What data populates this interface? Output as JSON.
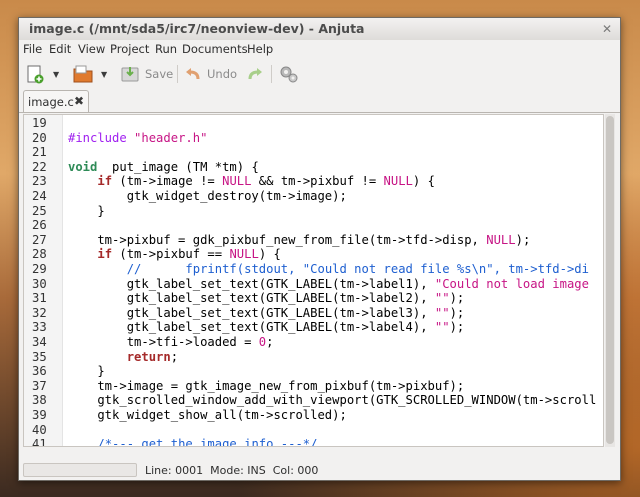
{
  "window": {
    "title": "image.c (/mnt/sda5/irc7/neonview-dev) - Anjuta",
    "close_glyph": "✕"
  },
  "menu": [
    "File",
    "Edit",
    "View",
    "Project",
    "Run",
    "Documents",
    "Help"
  ],
  "toolbar": {
    "save_label": "Save",
    "undo_label": "Undo"
  },
  "tab": {
    "label": "image.c",
    "close_glyph": "✖"
  },
  "editor": {
    "lines": [
      {
        "n": "19",
        "tokens": []
      },
      {
        "n": "20",
        "tokens": [
          [
            "pp",
            "#include "
          ],
          [
            "str",
            "\"header.h\""
          ]
        ]
      },
      {
        "n": "21",
        "tokens": []
      },
      {
        "n": "22",
        "tokens": [
          [
            "ty",
            "void"
          ],
          [
            "",
            "  put_image (TM *tm) {"
          ]
        ]
      },
      {
        "n": "23",
        "tokens": [
          [
            "",
            "    "
          ],
          [
            "kw",
            "if"
          ],
          [
            "",
            " (tm->image != "
          ],
          [
            "cn",
            "NULL"
          ],
          [
            "",
            " && tm->pixbuf != "
          ],
          [
            "cn",
            "NULL"
          ],
          [
            "",
            ") {"
          ]
        ]
      },
      {
        "n": "24",
        "tokens": [
          [
            "",
            "        gtk_widget_destroy(tm->image);"
          ]
        ]
      },
      {
        "n": "25",
        "tokens": [
          [
            "",
            "    }"
          ]
        ]
      },
      {
        "n": "26",
        "tokens": []
      },
      {
        "n": "27",
        "tokens": [
          [
            "",
            "    tm->pixbuf = gdk_pixbuf_new_from_file(tm->tfd->disp, "
          ],
          [
            "cn",
            "NULL"
          ],
          [
            "",
            ");"
          ]
        ]
      },
      {
        "n": "28",
        "tokens": [
          [
            "",
            "    "
          ],
          [
            "kw",
            "if"
          ],
          [
            "",
            " (tm->pixbuf == "
          ],
          [
            "cn",
            "NULL"
          ],
          [
            "",
            ") {"
          ]
        ]
      },
      {
        "n": "29",
        "tokens": [
          [
            "",
            "        "
          ],
          [
            "cm",
            "//      fprintf(stdout, \"Could not read file %s\\n\", tm->tfd->di"
          ]
        ]
      },
      {
        "n": "30",
        "tokens": [
          [
            "",
            "        gtk_label_set_text(GTK_LABEL(tm->label1), "
          ],
          [
            "str",
            "\"Could not load image"
          ]
        ]
      },
      {
        "n": "31",
        "tokens": [
          [
            "",
            "        gtk_label_set_text(GTK_LABEL(tm->label2), "
          ],
          [
            "str",
            "\"\""
          ],
          [
            "",
            ");"
          ]
        ]
      },
      {
        "n": "32",
        "tokens": [
          [
            "",
            "        gtk_label_set_text(GTK_LABEL(tm->label3), "
          ],
          [
            "str",
            "\"\""
          ],
          [
            "",
            ");"
          ]
        ]
      },
      {
        "n": "33",
        "tokens": [
          [
            "",
            "        gtk_label_set_text(GTK_LABEL(tm->label4), "
          ],
          [
            "str",
            "\"\""
          ],
          [
            "",
            ");"
          ]
        ]
      },
      {
        "n": "34",
        "tokens": [
          [
            "",
            "        tm->tfi->loaded = "
          ],
          [
            "num",
            "0"
          ],
          [
            "",
            ";"
          ]
        ]
      },
      {
        "n": "35",
        "tokens": [
          [
            "",
            "        "
          ],
          [
            "kw",
            "return"
          ],
          [
            "",
            ";"
          ]
        ]
      },
      {
        "n": "36",
        "tokens": [
          [
            "",
            "    }"
          ]
        ]
      },
      {
        "n": "37",
        "tokens": [
          [
            "",
            "    tm->image = gtk_image_new_from_pixbuf(tm->pixbuf);"
          ]
        ]
      },
      {
        "n": "38",
        "tokens": [
          [
            "",
            "    gtk_scrolled_window_add_with_viewport(GTK_SCROLLED_WINDOW(tm->scroll"
          ]
        ]
      },
      {
        "n": "39",
        "tokens": [
          [
            "",
            "    gtk_widget_show_all(tm->scrolled);"
          ]
        ]
      },
      {
        "n": "40",
        "tokens": []
      },
      {
        "n": "41",
        "tokens": [
          [
            "",
            "    "
          ],
          [
            "cm",
            "/*--- get the image info ---*/"
          ]
        ]
      }
    ]
  },
  "status": {
    "text": "Line: 0001  Mode: INS  Col: 000"
  },
  "colors": {
    "keyword": "#a52a2a",
    "type": "#2e8b57",
    "string": "#c71585",
    "comment": "#1e5fd0",
    "preprocessor": "#a020f0"
  }
}
